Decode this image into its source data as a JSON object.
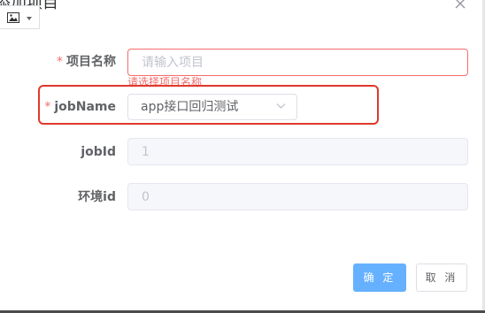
{
  "dialog": {
    "title": "添加项目"
  },
  "toolbar": {
    "image_dropdown_icon": "image-icon"
  },
  "form": {
    "project_name": {
      "required_mark": "*",
      "label": "项目名称",
      "placeholder": "请输入项目",
      "value": "",
      "error": "请选择项目名称"
    },
    "job_name": {
      "required_mark": "*",
      "label": "jobName",
      "selected": "app接口回归测试"
    },
    "job_id": {
      "label": "jobId",
      "value": "1"
    },
    "env_id": {
      "label": "环境id",
      "value": "0"
    }
  },
  "footer": {
    "confirm_label": "确 定",
    "cancel_label": "取 消"
  },
  "colors": {
    "primary": "#66b1ff",
    "error": "#f56c6c",
    "highlight": "#e0392b"
  }
}
